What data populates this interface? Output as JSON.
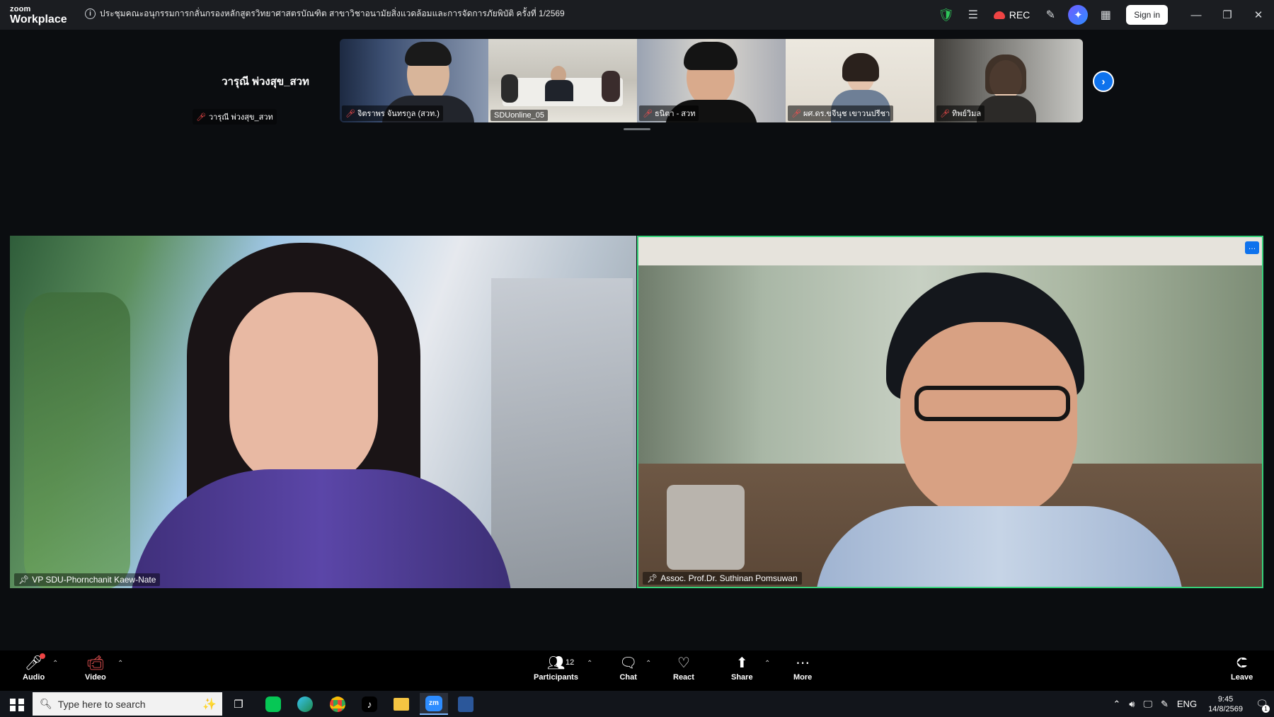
{
  "titlebar": {
    "logo_line1": "zoom",
    "logo_line2": "Workplace",
    "meeting_title": "ประชุมคณะอนุกรรมการกลั่นกรองหลักสูตรวิทยาศาสตรบัณฑิต สาขาวิชาอนามัยสิ่งแวดล้อมและการจัดการภัยพิบัติ ครั้งที่ 1/2569",
    "rec_label": "REC",
    "signin_label": "Sign in"
  },
  "gallery": {
    "self_name_big": "วารุณี พ่วงสุข_สวท",
    "self_label": "วารุณี พ่วงสุข_สวท",
    "thumbnails": [
      {
        "label": "จิตราพร จันทรกูล (สวท.)",
        "muted": true
      },
      {
        "label": "SDUonline_05",
        "muted": false
      },
      {
        "label": "ธนิตา - สวท",
        "muted": true
      },
      {
        "label": "ผศ.ดร.ขจีนุช เขาวนปรีชา",
        "muted": true
      },
      {
        "label": "ทิพย์วิมล",
        "muted": true
      }
    ]
  },
  "videos": {
    "left_name": "VP SDU-Phornchanit Kaew-Nate",
    "right_name": "Assoc. Prof.Dr. Suthinan Pomsuwan",
    "active_speaker_color": "#36d27a"
  },
  "toolbar": {
    "audio": "Audio",
    "video": "Video",
    "participants": "Participants",
    "participants_count": "12",
    "chat": "Chat",
    "react": "React",
    "share": "Share",
    "more": "More",
    "leave": "Leave"
  },
  "taskbar": {
    "search_placeholder": "Type here to search",
    "lang": "ENG",
    "time": "9:45",
    "date": "14/8/2569",
    "notification_count": "1",
    "apps": [
      "task-view",
      "line",
      "edge",
      "chrome",
      "tiktok",
      "file-explorer",
      "zoom",
      "word"
    ]
  },
  "colors": {
    "accent_blue": "#0e72ed",
    "rec_red": "#ef4444",
    "shield_green": "#2fc65a"
  }
}
